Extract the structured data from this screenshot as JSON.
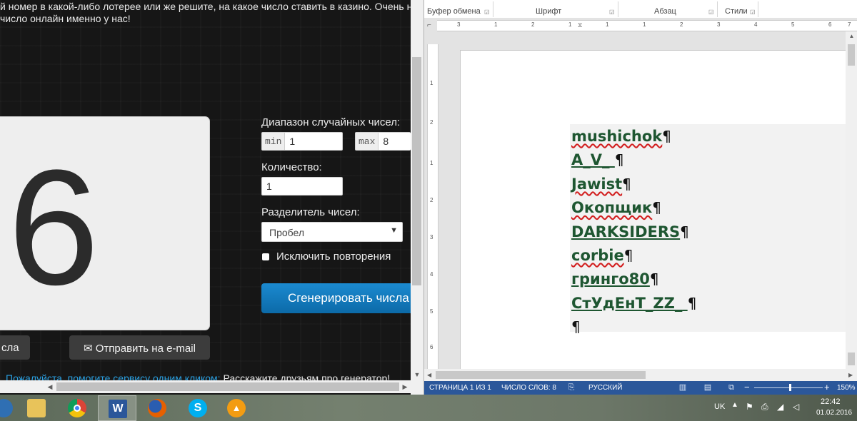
{
  "browser": {
    "intro_line1": "й номер в какой-либо лотерее или же решите, на какое число ставить в казино. Очень наде",
    "intro_line2": "число онлайн именно у нас!",
    "result_number": "6",
    "range_label": "Диапазон случайных чисел:",
    "min_addon": "min",
    "min_value": "1",
    "max_addon": "max",
    "max_value": "8",
    "count_label": "Количество:",
    "count_value": "1",
    "separator_label": "Разделитель чисел:",
    "separator_value": "Пробел",
    "exclude_label": "Исключить повторения",
    "generate_button": "Сгенерировать числа",
    "left_button": "сла",
    "email_button": "✉ Отправить на e-mail",
    "help_link": "Пожалуйста, помогите сервису одним кликом:",
    "help_rest": " Расскажите друзьям про генератор!"
  },
  "word": {
    "ribbon_groups": [
      "Буфер обмена",
      "Шрифт",
      "Абзац",
      "Стили"
    ],
    "ruler_numbers": [
      "3",
      "1",
      "2",
      "1",
      "1",
      "1",
      "2",
      "3",
      "4",
      "5",
      "6",
      "7"
    ],
    "vruler_numbers": [
      "1",
      "2",
      "1",
      "2",
      "3",
      "4",
      "5",
      "6"
    ],
    "doc_lines": [
      {
        "text": "mushichok",
        "spell": true,
        "trail": ""
      },
      {
        "text": "A_V_",
        "spell": false,
        "trail": " "
      },
      {
        "text": "Jawist",
        "spell": true,
        "trail": ""
      },
      {
        "text": "Окопщик",
        "spell": true,
        "trail": ""
      },
      {
        "text": "DARKSIDERS",
        "spell": false,
        "trail": ""
      },
      {
        "text": "corbie",
        "spell": true,
        "trail": ""
      },
      {
        "text": "гринго80",
        "spell": false,
        "trail": ""
      },
      {
        "text": "СтУдЕнТ_ZZ_",
        "spell": false,
        "trail": " "
      },
      {
        "text": "",
        "spell": false,
        "trail": ""
      }
    ],
    "pilcrow": "¶",
    "status": {
      "page": "СТРАНИЦА 1 ИЗ 1",
      "words": "ЧИСЛО СЛОВ: 8",
      "language": "РУССКИЙ",
      "zoom": "150%"
    }
  },
  "taskbar": {
    "apps": [
      "file-explorer",
      "chrome",
      "word",
      "firefox",
      "skype",
      "aimp"
    ],
    "word_glyph": "W",
    "skype_glyph": "S",
    "lang": "UK",
    "time": "22:42",
    "date": "01.02.2016"
  },
  "colors": {
    "accent_blue": "#2b579a",
    "generate_blue": "#1b8ad0",
    "doc_green": "#1e5631"
  }
}
